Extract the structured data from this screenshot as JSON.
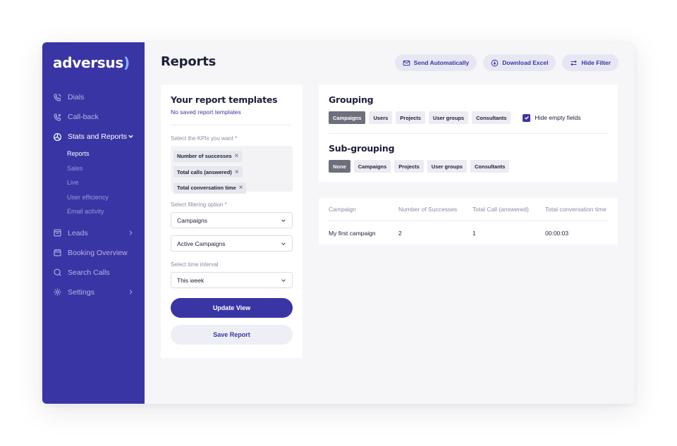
{
  "sidebar": {
    "logo": "adversus",
    "logo_paren": ")",
    "items": [
      {
        "label": "Dials",
        "icon": "phone-icon"
      },
      {
        "label": "Call-back",
        "icon": "phone-callback-icon"
      },
      {
        "label": "Stats and Reports",
        "icon": "pie-chart-icon"
      },
      {
        "label": "Leads",
        "icon": "inbox-icon"
      },
      {
        "label": "Booking Overview",
        "icon": "calendar-icon"
      },
      {
        "label": "Search Calls",
        "icon": "search-icon"
      },
      {
        "label": "Settings",
        "icon": "gear-icon"
      }
    ],
    "sub_items": [
      "Reports",
      "Sales",
      "Live",
      "User efficiency",
      "Email activity"
    ]
  },
  "header": {
    "title": "Reports",
    "actions": {
      "send": "Send Automatically",
      "download": "Download Excel",
      "hide": "Hide Filter"
    }
  },
  "templates": {
    "title": "Your report templates",
    "empty_link": "No saved report templates",
    "kpi_label": "Select the KPIs you want *",
    "kpis": [
      "Number of successes",
      "Total calls (answered)",
      "Total conversation time"
    ],
    "filter_label": "Select filtering option *",
    "filter_value": "Campaigns",
    "filter_sub_value": "Active Campaigns",
    "time_label": "Select time interval",
    "time_value": "This week",
    "update_btn": "Update View",
    "save_btn": "Save Report"
  },
  "grouping": {
    "title": "Grouping",
    "chips": [
      "Campaigns",
      "Users",
      "Projects",
      "User groups",
      "Consultants"
    ],
    "selected": "Campaigns",
    "hide_empty_label": "Hide empty fields",
    "hide_empty_checked": true,
    "sub_title": "Sub-grouping",
    "sub_chips": [
      "None",
      "Campaigns",
      "Projects",
      "User groups",
      "Consultants"
    ],
    "sub_selected": "None"
  },
  "table": {
    "columns": [
      "Campaign",
      "Number of Successes",
      "Total Call (answered)",
      "Total conversation time"
    ],
    "rows": [
      [
        "My first campaign",
        "2",
        "1",
        "00:00:03"
      ]
    ]
  },
  "colors": {
    "sidebar": "#3a35a4",
    "accent": "#3a35a4",
    "selected_chip": "#6e6f7c"
  }
}
